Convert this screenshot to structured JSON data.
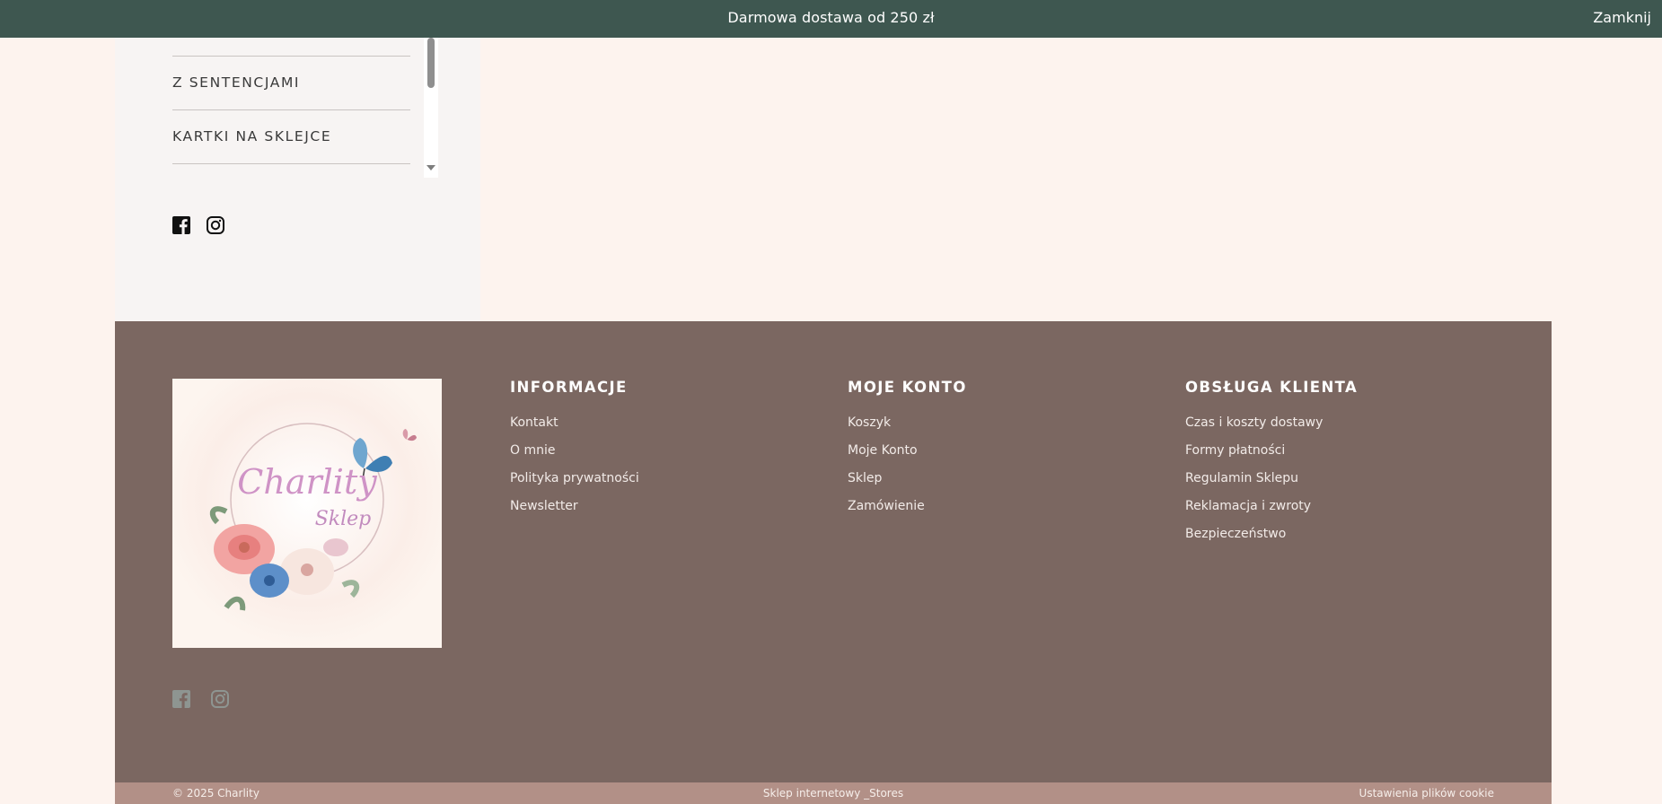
{
  "announcement": {
    "text": "Darmowa dostawa od 250 zł",
    "close_label": "Zamknij"
  },
  "sidebar": {
    "categories": [
      {
        "label": "Z SENTENCJAMI"
      },
      {
        "label": "KARTKI NA SKLEJCE"
      }
    ],
    "social": [
      "facebook-icon",
      "instagram-icon"
    ]
  },
  "footer": {
    "logo": {
      "line1": "Charlity",
      "line2": "Sklep"
    },
    "columns": [
      {
        "title": "INFORMACJE",
        "links": [
          "Kontakt",
          "O mnie",
          "Polityka prywatności",
          "Newsletter"
        ]
      },
      {
        "title": "MOJE KONTO",
        "links": [
          "Koszyk",
          "Moje Konto",
          "Sklep",
          "Zamówienie"
        ]
      },
      {
        "title": "OBSŁUGA KLIENTA",
        "links": [
          "Czas i koszty dostawy",
          "Formy płatności",
          "Regulamin Sklepu",
          "Reklamacja i zwroty",
          "Bezpieczeństwo"
        ]
      }
    ],
    "social": [
      "facebook-icon",
      "instagram-icon"
    ]
  },
  "bottom_bar": {
    "copyright": "© 2025 Charlity",
    "platform": "Sklep internetowy _Stores",
    "cookie_settings": "Ustawienia plików cookie"
  },
  "colors": {
    "top_bar": "#3e5750",
    "page_bg": "#fdf3ee",
    "sidebar_bg": "#f7f4f3",
    "footer_bg": "#7b6761",
    "bottom_bar_bg": "#b29087"
  }
}
